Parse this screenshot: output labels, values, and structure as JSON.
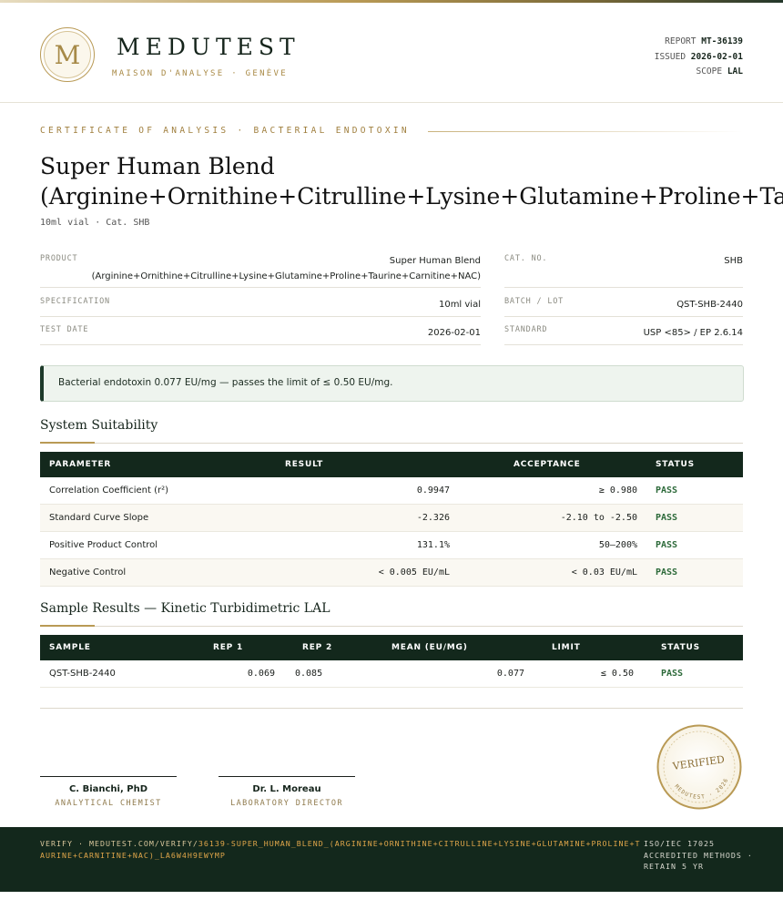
{
  "header": {
    "logo_letter": "M",
    "brand": "MEDUTEST",
    "tagline": "MAISON D'ANALYSE · GENÈVE",
    "report_label": "REPORT",
    "report_value": "MT-36139",
    "issued_label": "ISSUED",
    "issued_value": "2026-02-01",
    "scope_label": "SCOPE",
    "scope_value": "LAL"
  },
  "certificate": {
    "label": "CERTIFICATE OF ANALYSIS · BACTERIAL ENDOTOXIN",
    "title_line1": "Super Human Blend",
    "title_line2": "(Arginine+Ornithine+Citrulline+Lysine+Glutamine+Proline+Taurine+Carnitine+NAC)",
    "subtitle": "10ml vial  ·  Cat. SHB"
  },
  "details": {
    "product_label": "PRODUCT",
    "product_line1": "Super Human Blend",
    "product_line2": "(Arginine+Ornithine+Citrulline+Lysine+Glutamine+Proline+Taurine+Carnitine+NAC)",
    "specification_label": "SPECIFICATION",
    "specification_value": "10ml vial",
    "test_date_label": "TEST DATE",
    "test_date_value": "2026-02-01",
    "cat_label": "CAT. NO.",
    "cat_value": "SHB",
    "batch_label": "BATCH / LOT",
    "batch_value": "QST-SHB-2440",
    "standard_label": "STANDARD",
    "standard_value": "USP <85> / EP 2.6.14"
  },
  "result_banner": "Bacterial endotoxin 0.077 EU/mg — passes the limit of ≤ 0.50 EU/mg.",
  "suitability": {
    "title": "System Suitability",
    "columns": [
      "PARAMETER",
      "RESULT",
      "ACCEPTANCE",
      "STATUS"
    ],
    "rows": [
      {
        "parameter": "Correlation Coefficient (r²)",
        "result": "0.9947",
        "acceptance": "≥ 0.980",
        "status": "PASS"
      },
      {
        "parameter": "Standard Curve Slope",
        "result": "-2.326",
        "acceptance": "-2.10 to -2.50",
        "status": "PASS"
      },
      {
        "parameter": "Positive Product Control",
        "result": "131.1%",
        "acceptance": "50–200%",
        "status": "PASS"
      },
      {
        "parameter": "Negative Control",
        "result": "< 0.005 EU/mL",
        "acceptance": "< 0.03 EU/mL",
        "status": "PASS"
      }
    ]
  },
  "samples": {
    "title": "Sample Results — Kinetic Turbidimetric LAL",
    "columns": [
      "SAMPLE",
      "REP 1",
      "REP 2",
      "MEAN (EU/MG)",
      "LIMIT",
      "STATUS"
    ],
    "rows": [
      {
        "sample": "QST-SHB-2440",
        "rep1": "0.069",
        "rep2": "0.085",
        "mean": "0.077",
        "limit": "≤ 0.50",
        "status": "PASS"
      }
    ]
  },
  "signatures": [
    {
      "name": "C. Bianchi, PhD",
      "role": "ANALYTICAL CHEMIST"
    },
    {
      "name": "Dr. L. Moreau",
      "role": "LABORATORY DIRECTOR"
    }
  ],
  "seal": {
    "text_top": "VERIFIED",
    "text_bottom": "MEDUTEST · 2026"
  },
  "footer": {
    "verify_prefix": "VERIFY · MEDUTEST.COM/VERIFY/",
    "verify_code": "36139-SUPER_HUMAN_BLEND_(ARGININE+ORNITHINE+CITRULLINE+LYSINE+GLUTAMINE+PROLINE+TAURINE+CARNITINE+NAC)_LA6W4H9EWYMP",
    "accreditation": "ISO/IEC 17025 ACCREDITED METHODS · RETAIN 5 YR"
  },
  "colors": {
    "accent_gold": "#b99a55",
    "dark_green": "#13281c",
    "pass_green": "#2d6a3a"
  }
}
